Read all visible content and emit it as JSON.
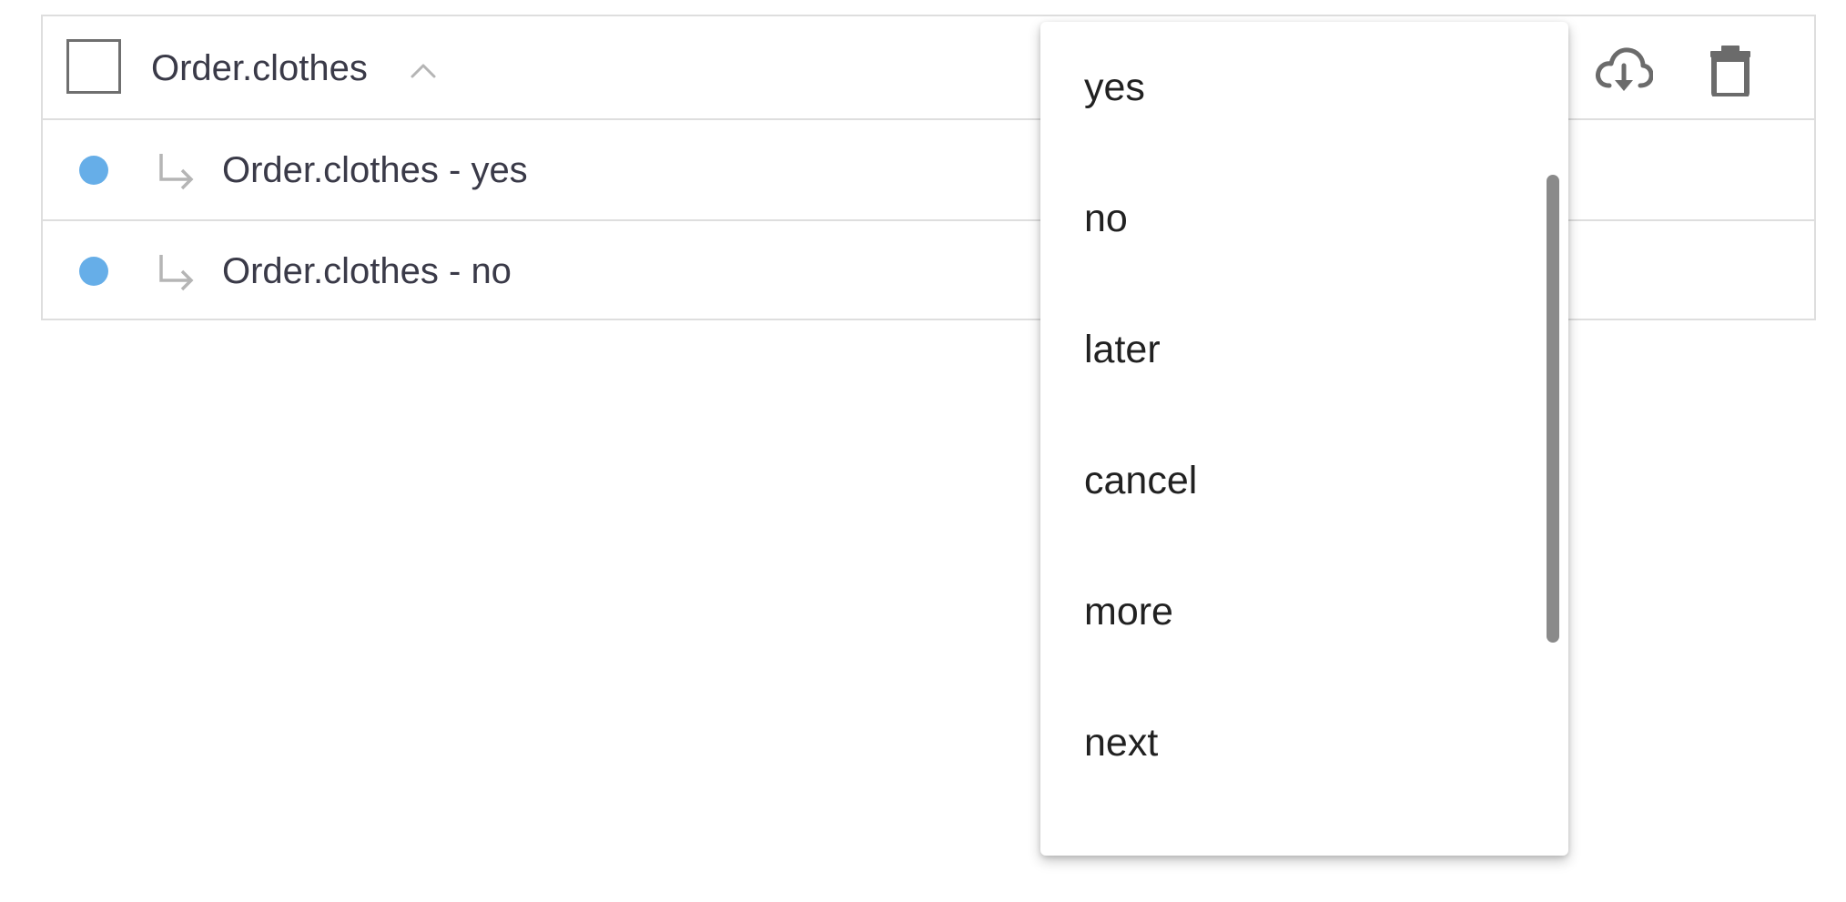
{
  "intent": {
    "title": "Order.clothes",
    "children": [
      {
        "label": "Order.clothes - yes"
      },
      {
        "label": "Order.clothes - no"
      }
    ]
  },
  "actions": {
    "download_icon": "cloud-download-icon",
    "delete_icon": "trash-icon"
  },
  "dropdown": {
    "options": [
      "yes",
      "no",
      "later",
      "cancel",
      "more",
      "next"
    ]
  },
  "colors": {
    "status_dot": "#66aee8",
    "border": "#dedede",
    "scrollbar": "#8a8a8a"
  }
}
